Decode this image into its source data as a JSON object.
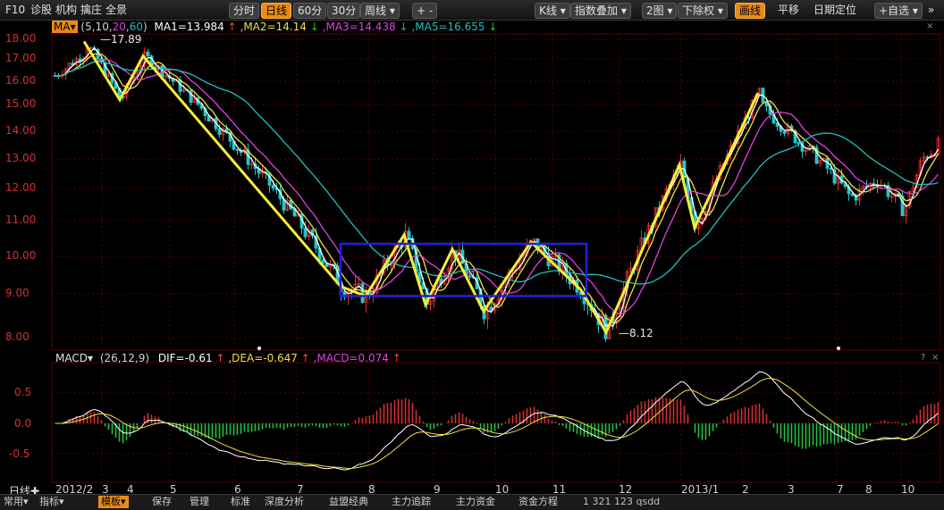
{
  "toolbar": {
    "left_items": [
      "F10",
      "诊股",
      "机构",
      "擒庄",
      "全景"
    ],
    "periods": [
      "分时",
      "日线",
      "60分",
      "30分"
    ],
    "period_active": "日线",
    "week_dropdown": "周线",
    "plus_minus": "+ -",
    "right_items": {
      "kline": "K线",
      "index_overlay": "指数叠加",
      "two_charts": "2图",
      "exrights": "下除权",
      "draw_line": "画线",
      "pan": "平移",
      "date_locate": "日期定位",
      "custom": "自选",
      "more": "»"
    }
  },
  "legend": {
    "ma_button": "MA",
    "ma_params_open": "(5,10,",
    "ma_param_20": "20",
    "ma_param_sep": ",",
    "ma_param_60": "60",
    "ma_params_close": ")",
    "ma1": "MA1=13.984",
    "ma1_arrow": "↑",
    "ma2": ",MA2=14.14",
    "ma2_arrow": "↓",
    "ma3": ",MA3=14.438",
    "ma3_arrow": "↓",
    "ma5": ",MA5=16.655",
    "ma5_arrow": "↓"
  },
  "macd_legend": {
    "name": "MACD",
    "params": "(26,12,9)",
    "dif": "DIF=-0.61",
    "dif_arrow": "↑",
    "dea": ",DEA=-0.647",
    "dea_arrow": "↑",
    "macd": ",MACD=0.074",
    "macd_arrow": "↑"
  },
  "price_ticks": [
    "18.00",
    "17.00",
    "16.00",
    "15.00",
    "14.00",
    "13.00",
    "12.00",
    "11.00",
    "10.00",
    "9.00",
    "8.00"
  ],
  "macd_ticks": [
    "0.5",
    "0.0",
    "-0.5"
  ],
  "annotations": {
    "high": "17.89",
    "low": "8.12"
  },
  "x_axis": {
    "label": "日线",
    "ticks": [
      "2012/2",
      "3",
      "4",
      "5",
      "6",
      "7",
      "8",
      "9",
      "10",
      "11",
      "12",
      "2013/1",
      "2",
      "3",
      "7",
      "8",
      "10"
    ]
  },
  "bottom_bar": {
    "items": [
      "常用",
      "指标",
      "模板",
      "保存",
      "管理",
      "标准",
      "深度分析",
      "益盟经典",
      "主力追踪",
      "主力资金",
      "资金方程"
    ],
    "active": "模板",
    "status": "1 321 123 qsdd"
  },
  "colors": {
    "background": "#000000",
    "grid": "#5a0000",
    "up": "#e03030",
    "down": "#29c6c6",
    "zigzag": "#f4ee3a",
    "box": "#2020e0",
    "ma1": "#ffffff",
    "ma2": "#f0e040",
    "ma3": "#e040e0",
    "ma5": "#20c0c0",
    "price_axis": "#d23232",
    "accent": "#e98a17"
  },
  "chart_data": {
    "type": "candlestick",
    "price_range": [
      8.0,
      18.0
    ],
    "macd_range": [
      -0.9,
      0.9
    ],
    "zigzag_prices": [
      17.89,
      15.2,
      17.15,
      9.2,
      8.95,
      10.6,
      8.75,
      10.2,
      8.6,
      10.4,
      9.1,
      8.12,
      12.8,
      10.8,
      15.5
    ],
    "box": {
      "price_low": 8.95,
      "price_high": 10.35
    }
  }
}
